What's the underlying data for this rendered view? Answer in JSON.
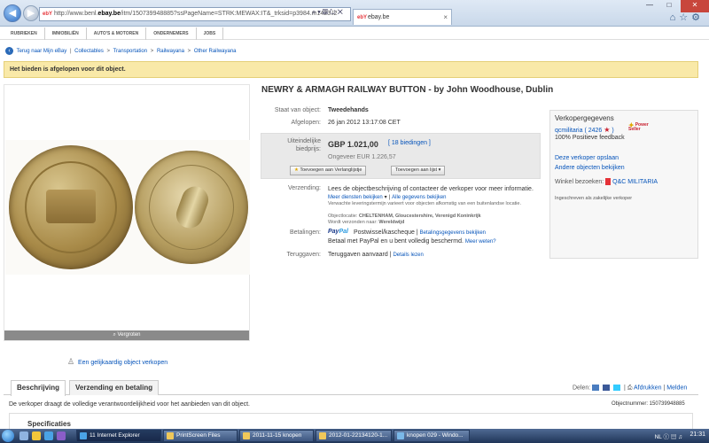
{
  "browser": {
    "url_prefix": "http://www.benl.",
    "url_domain": "ebay.be",
    "url_rest": "/itm/150739948885?ssPageName=STRK:MEWAX:IT&_trksid=p3984.m1423.l2",
    "tab_title": "ebay.be",
    "favicon": "ebay"
  },
  "topnav": {
    "items": [
      "RUBRIEKEN",
      "IMMOBILIËN",
      "AUTO'S & MOTOREN",
      "ONDERNEMERS",
      "JOBS"
    ]
  },
  "breadcrumb": {
    "back_label": "Terug naar Mijn eBay",
    "crumbs": [
      "Collectables",
      "Transportation",
      "Railwayana",
      "Other Railwayana"
    ]
  },
  "banner": "Het bieden is afgelopen voor dit object.",
  "item": {
    "title": "NEWRY & ARMAGH RAILWAY BUTTON - by John Woodhouse, Dublin",
    "condition_label": "Staat van object:",
    "condition": "Tweedehands",
    "ended_label": "Afgelopen:",
    "ended": "26 jan 2012 13:17:08 CET",
    "final_label_1": "Uiteindelijke",
    "final_label_2": "biedprijs:",
    "price": "GBP 1.021,00",
    "bids": "[ 18 biedingen ]",
    "approx": "Ongeveer EUR 1.226,57",
    "watchlist_btn": "Toevoegen aan Verlanglijstje",
    "list_btn": "Toevoegen aan lijst",
    "shipping_label": "Verzending:",
    "shipping_text": "Lees de objectbeschrijving of contacteer de verkoper voor meer informatie.",
    "more_services": "Meer diensten bekijken",
    "all_details": "Alle gegevens bekijken",
    "delivery_note": "Verwachte leveringstermijn varieert voor objecten afkomstig van een buitenlandse locatie.",
    "location_label": "Objectlocatie:",
    "location": "CHELTENHAM, Gloucestershire, Verenigd Koninkrijk",
    "ships_to_label": "Wordt verzonden naar:",
    "ships_to": "Wereldwijd",
    "payment_label": "Betalingen:",
    "paypal_pay": "Pay",
    "paypal_pal": "Pal",
    "payment_methods": "Postwissel/kascheque",
    "payment_details": "Betalingsgegevens bekijken",
    "paypal_protect": "Betaal met PayPal en u bent volledig beschermd.",
    "learn_more": "Meer weten?",
    "returns_label": "Teruggaven:",
    "returns": "Teruggaven aanvaard",
    "returns_details": "Details lezen",
    "enlarge": "Vergroten",
    "sell_similar": "Een gelijkaardig object verkopen"
  },
  "seller": {
    "title": "Verkopergegevens",
    "name": "qcmilitaria",
    "score": "( 2426",
    "score_end": ")",
    "badge_1": "Power",
    "badge_2": "Seller",
    "feedback": "100% Positieve feedback",
    "save_link": "Deze verkoper opslaan",
    "other_link": "Andere objecten bekijken",
    "store_label": "Winkel bezoeken:",
    "store_name": "Q&C MILITARIA",
    "business": "Ingeschreven als zakelijke verkoper"
  },
  "tabs": {
    "description": "Beschrijving",
    "shipping": "Verzending en betaling"
  },
  "share": {
    "label": "Delen:",
    "print": "Afdrukken",
    "report": "Melden"
  },
  "footer": {
    "disclaimer": "De verkoper draagt de volledige verantwoordelijkheid voor het aanbieden van dit object.",
    "objnum": "Objectnummer: 150739948885",
    "specs": "Specificaties"
  },
  "taskbar": {
    "items": [
      "11 Internet Explorer",
      "PrintScreen Files",
      "2011-11-15 knopen",
      "2012-01-22134120-1...",
      "knopen 029 - Windo..."
    ],
    "tray": "NL",
    "clock": "21:31"
  }
}
